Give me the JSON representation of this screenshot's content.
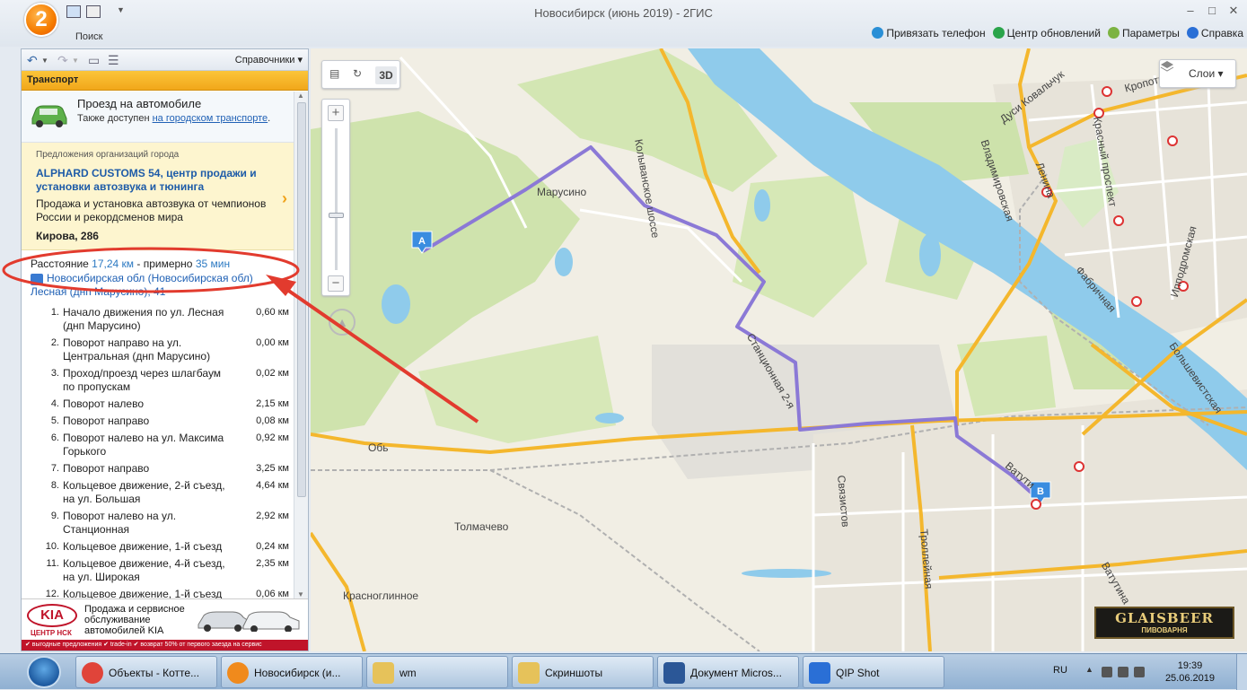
{
  "window": {
    "title": "Новосибирск (июнь 2019) - 2ГИС",
    "logo_text": "2",
    "search_label": "Поиск",
    "controls": {
      "minimize": "‒",
      "maximize": "□",
      "close": "✕"
    },
    "toolbar_right": [
      {
        "label": "Привязать телефон",
        "icon": "phone-link-icon",
        "color": "#2a8fd6"
      },
      {
        "label": "Центр обновлений",
        "icon": "update-icon",
        "color": "#2aa44a"
      },
      {
        "label": "Параметры",
        "icon": "gear-icon",
        "color": "#7cb342"
      },
      {
        "label": "Справка",
        "icon": "help-icon",
        "color": "#2a6fd6"
      }
    ]
  },
  "left_panel": {
    "directories_label": "Справочники",
    "header": "Транспорт",
    "car": {
      "title": "Проезд на автомобиле",
      "sub_prefix": "Также доступен ",
      "sub_link": "на городском транспорте",
      "sub_suffix": "."
    },
    "ad": {
      "heading": "Предложения организаций города",
      "name": "ALPHARD CUSTOMS 54, центр продажи и установки автозвука и тюнинга",
      "description": "Продажа и установка автозвука от чемпионов России и рекордсменов мира",
      "address": "Кирова, 286",
      "arrow": "›"
    },
    "distance": {
      "label": "Расстояние ",
      "value": "17,24 км",
      "middle": " - примерно ",
      "time": "35 мин"
    },
    "route_address": "Новосибирская обл (Новосибирская обл) Лесная (днп Марусино), 41",
    "steps": [
      {
        "n": "1.",
        "text": "Начало движения по ул. Лесная (днп Марусино)",
        "dist": "0,60 км"
      },
      {
        "n": "2.",
        "text": "Поворот направо на ул. Центральная (днп Марусино)",
        "dist": "0,00 км"
      },
      {
        "n": "3.",
        "text": "Проход/проезд через шлагбаум по пропускам",
        "dist": "0,02 км"
      },
      {
        "n": "4.",
        "text": "Поворот налево",
        "dist": "2,15 км"
      },
      {
        "n": "5.",
        "text": "Поворот направо",
        "dist": "0,08 км"
      },
      {
        "n": "6.",
        "text": "Поворот налево на ул. Максима Горького",
        "dist": "0,92 км"
      },
      {
        "n": "7.",
        "text": "Поворот направо",
        "dist": "3,25 км"
      },
      {
        "n": "8.",
        "text": "Кольцевое движение, 2-й съезд, на ул. Большая",
        "dist": "4,64 км"
      },
      {
        "n": "9.",
        "text": "Поворот налево на ул. Станционная",
        "dist": "2,92 км"
      },
      {
        "n": "10.",
        "text": "Кольцевое движение, 1-й съезд",
        "dist": "0,24 км"
      },
      {
        "n": "11.",
        "text": "Кольцевое движение, 4-й съезд, на ул. Широкая",
        "dist": "2,35 км"
      },
      {
        "n": "12.",
        "text": "Кольцевое движение, 1-й съезд",
        "dist": "0,06 км"
      }
    ],
    "kia": {
      "logo": "KIA",
      "center": "ЦЕНТР НСК",
      "text": "Продажа и сервисное обслуживание автомобилей KIA",
      "strip": "✔ выгодные предложения  ✔ trade-in  ✔ возврат 50% от первого заезда на сервис"
    }
  },
  "map": {
    "btn_3d": "3D",
    "zoom_in": "+",
    "zoom_out": "−",
    "layers_label": "Слои",
    "marker_a": "A",
    "marker_b": "B",
    "labels": {
      "marusino": "Марусино",
      "kolyvan": "Колыванское шоссе",
      "stantsionnaya": "Станционная 2-я",
      "ob": "Обь",
      "tolmachevo": "Толмачево",
      "krasnoglinnoe": "Красноглинное",
      "svyazistov": "Связистов",
      "troleynaya": "Троллейная",
      "vatutina": "Ватутина",
      "vatu": "Ватути",
      "dusi": "Дуси Ковальчук",
      "kropotkina": "Кропоткина",
      "vladimirovskaya": "Владимировская",
      "krasny": "Красный проспект",
      "lenina": "Ленина",
      "ippodromskaya": "Ипподромская",
      "fabrichnaya": "Фабричная",
      "bolshevistskaya": "Большевистская"
    },
    "ad_logo": "GLAISBEER",
    "ad_sub": "ПИВОВАРНЯ"
  },
  "taskbar": {
    "items": [
      {
        "label": "Объекты - Котте...",
        "icon": "chrome-icon",
        "color": "#e0443a"
      },
      {
        "label": "Новосибирск (и...",
        "icon": "2gis-icon",
        "color": "#f08a1c"
      },
      {
        "label": "wm",
        "icon": "folder-icon",
        "color": "#e6c25a"
      },
      {
        "label": "Скриншоты",
        "icon": "folder-icon",
        "color": "#e6c25a"
      },
      {
        "label": "Документ Micros...",
        "icon": "word-icon",
        "color": "#2b5797"
      },
      {
        "label": "QIP Shot",
        "icon": "qipshot-icon",
        "color": "#2a6fd6"
      }
    ],
    "lang": "RU",
    "time": "19:39",
    "date": "25.06.2019"
  },
  "colors": {
    "route": "#8b79d6",
    "road_major": "#f4b72d",
    "water": "#8fcbeb",
    "green": "#cde3ab",
    "annotation": "#e23b2e"
  }
}
